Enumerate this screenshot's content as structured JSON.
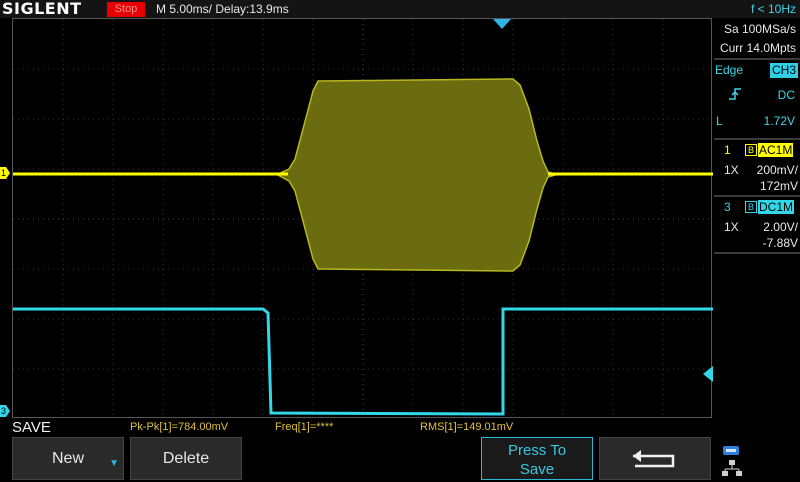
{
  "header": {
    "brand": "SIGLENT",
    "run_state": "Stop",
    "timebase": "M 5.00ms/ Delay:13.9ms",
    "trigger_freq": "f < 10Hz"
  },
  "acquisition": {
    "sample_rate": "Sa 100MSa/s",
    "memory_depth": "Curr 14.0Mpts"
  },
  "trigger": {
    "type_label": "Edge",
    "source": "CH3",
    "slope_icon": "rising-edge-icon",
    "coupling": "DC",
    "level_label": "L",
    "level": "1.72V"
  },
  "channels": [
    {
      "number": "1",
      "bw_badge": "B",
      "coupling": "AC1M",
      "probe": "1X",
      "scale": "200mV/",
      "offset": "172mV",
      "color": "#ffff00"
    },
    {
      "number": "3",
      "bw_badge": "B",
      "coupling": "DC1M",
      "probe": "1X",
      "scale": "2.00V/",
      "offset": "-7.88V",
      "color": "#33d7e8"
    }
  ],
  "markers": {
    "ch1": "1",
    "ch3": "3"
  },
  "measurements": {
    "mode_title": "SAVE",
    "pkpk": "Pk-Pk[1]=784.00mV",
    "freq": "Freq[1]=****",
    "rms": "RMS[1]=149.01mV"
  },
  "softkeys": {
    "new": "New",
    "delete": "Delete",
    "press_to": "Press To",
    "save": "Save",
    "back_icon": "return-arrow-icon"
  },
  "status_icons": [
    "usb-icon",
    "network-icon"
  ]
}
